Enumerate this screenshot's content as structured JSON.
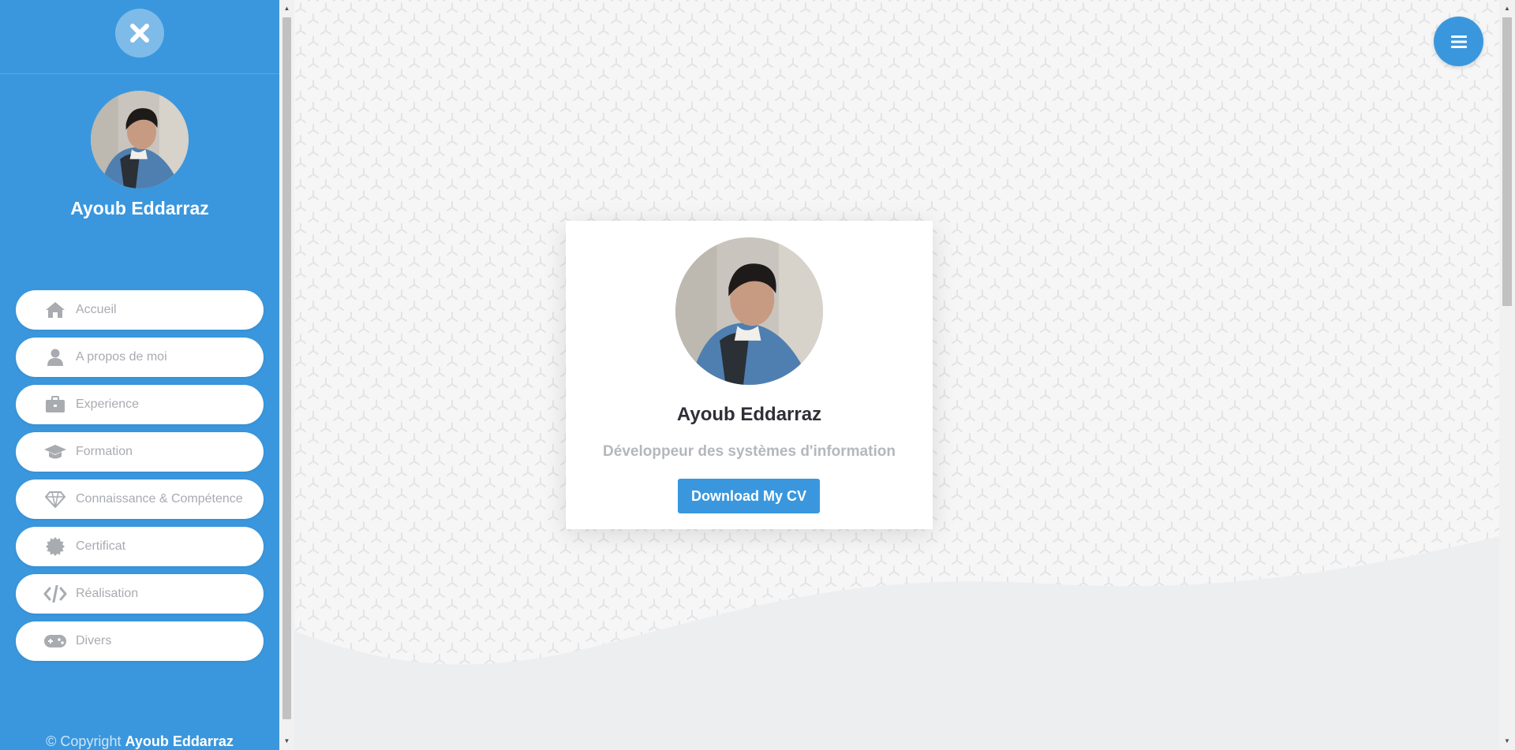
{
  "profile": {
    "name": "Ayoub Eddarraz",
    "title": "Développeur des systèmes d'information"
  },
  "sidebar": {
    "close_icon": "close-icon",
    "items": [
      {
        "label": "Accueil",
        "icon": "home-icon"
      },
      {
        "label": "A propos de moi",
        "icon": "user-icon"
      },
      {
        "label": "Experience",
        "icon": "briefcase-icon"
      },
      {
        "label": "Formation",
        "icon": "graduation-cap-icon"
      },
      {
        "label": "Connaissance & Compétence",
        "icon": "diamond-icon"
      },
      {
        "label": "Certificat",
        "icon": "certificate-icon"
      },
      {
        "label": "Réalisation",
        "icon": "code-icon"
      },
      {
        "label": "Divers",
        "icon": "gamepad-icon"
      }
    ],
    "copyright_prefix": "© Copyright",
    "copyright_name": "Ayoub Eddarraz"
  },
  "card": {
    "button_label": "Download My CV"
  },
  "header": {
    "menu_icon": "hamburger-menu-icon"
  },
  "colors": {
    "primary": "#3a97dd",
    "nav_text": "#a8abb0",
    "muted_text": "#b4b7bc",
    "dark_text": "#2f2f36",
    "wave": "#eceef0"
  }
}
